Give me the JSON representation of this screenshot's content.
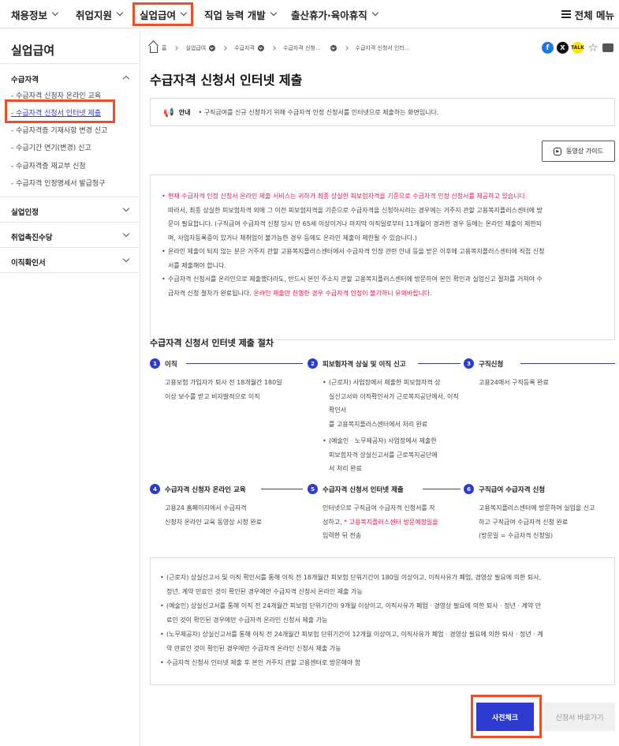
{
  "nav": {
    "items": [
      "채용정보",
      "취업지원",
      "실업급여",
      "직업 능력 개발",
      "출산휴가·육아휴직"
    ],
    "all_menu": "전체 메뉴"
  },
  "sidebar": {
    "title": "실업급여",
    "categories": [
      {
        "label": "수급자격",
        "sub": [
          "수급자격 신청자 온라인 교육",
          "수급자격 신청서 인터넷 제출",
          "수급자격증 기재사항 변경 신고",
          "수급기간 연기(변경) 신고",
          "수급자격증 재교부 신청",
          "수급자격 인정명세서 발급청구"
        ]
      },
      {
        "label": "실업인정"
      },
      {
        "label": "취업촉진수당"
      },
      {
        "label": "이직확인서"
      }
    ]
  },
  "breadcrumb": [
    "홈",
    "실업급여",
    "수급자격",
    "수급자격 신청...",
    "수급자격 신청서 인터..."
  ],
  "page_title": "수급자격 신청서 인터넷 제출",
  "notice": {
    "label": "안내",
    "text": "• 구직급여를 신규 신청하기 위해 수급자격 인정 신청서를 인터넷으로 제출하는 화면입니다."
  },
  "video_guide": "동영상 가이드",
  "info": {
    "p1": "현재 수급자격 인정 신청서 온라인 제출 서비스는 귀하가 최종 상실한 피보험자격을 기준으로 수급자격 인정 신청서를 제공하고 있습니다.",
    "p1b": "따라서, 최종 상실한 피보험자격 외에 그 이전 피보험자격을 기준으로 수급자격을 신청하시려는 경우에는 거주지 관할 고용복지플러스센터에 방",
    "p1c": "문이 필요합니다. (구직급여 수급자격 신청 당시 만 65세 이상이거나 마지막 이직일로부터 11개월이 경과한 경우 등에는 온라인 제출이 제한되",
    "p1d": "며, 사업자등록증이 있거나 재취업이 불가능한 경우 등에도 온라인 제출이 제한될 수 있습니다.)",
    "p2": "온라인 제출이 되지 않는 분은 거주지 관할 고용복지플러스센터에서 수급자격 인정 관련 안내 등을 받은 이후에 고용복지플러스센터에 직접 신청",
    "p2b": "서를 제출해야 합니다.",
    "p3": "수급자격 신청서를 온라인으로 제출했더라도, 반드시 본인 주소지 관할 고용복지플러스센터에 방문하여 본인 확인과 실업신고 절차를 거쳐야 수",
    "p3b": "급자격 신청 절차가 완료됩니다. ",
    "p3_red": "온라인 제출만 진행한 경우 수급자격 인정이 불가하니 유의바랍니다."
  },
  "procedure_title": "수급자격 신청서 인터넷 제출 절차",
  "steps": [
    {
      "num": "1",
      "title": "이직",
      "lines": [
        "고용보험 가입자가 퇴사 전 18개월간 180일",
        "이상 보수를 받고 비자발적으로 이직"
      ]
    },
    {
      "num": "2",
      "title": "피보험자격 상실 및 이직 신고",
      "b1": [
        "(근로자) 사업장에서 제출한 피보험자격 상",
        "실신고서와 이직확인서가 근로복지공단에서, 이직확인서",
        "를 고용복지플러스센터에서 처리 완료"
      ],
      "b2": [
        "(예술인 · 노무제공자) 사업장에서 제출한",
        "피보험자격 상실신고서를 근로복지공단에",
        "서 처리 완료"
      ]
    },
    {
      "num": "3",
      "title": "구직신청",
      "lines": [
        "고용24에서 구직등록 완료"
      ]
    },
    {
      "num": "4",
      "title": "수급자격 신청자 온라인 교육",
      "lines": [
        "고용24 홈페이지에서 수급자격",
        "신청자 온라인 교육 동영상 시청 완료"
      ]
    },
    {
      "num": "5",
      "title": "수급자격 신청서 인터넷 제출",
      "lines": [
        "인터넷으로 구직급여 수급자격 신청서를 작",
        "성하고, ",
        "입력한 뒤 전송"
      ],
      "red": "* 고용복지플러스센터 방문예정일을"
    },
    {
      "num": "6",
      "title": "구직급여 수급자격 신청",
      "lines": [
        "고용복지플러스센터에 방문하여 실업을 신고",
        "하고 구직급여 수급자격 신청 완료",
        "(방문일 = 수급자격 신청일)"
      ]
    }
  ],
  "conditions": [
    "(근로자) 상실신고서 및 이직 확인서를 통해 이직 전 18개월간 피보험 단위기간이 180일 이상이고, 이직사유가 폐업, 경영상 필요에 의한 퇴사,",
    "정년, 계약 만료인 것이 확인된 경우에만 수급자격 신청서 온라인 제출 가능",
    "(예술인) 상실신고서를 통해 이직 전 24개월간 피보험 단위기간이 9개월 이상이고, 이직사유가 폐업 · 경영상 필요에 의한 퇴사 · 정년 · 계약 만",
    "료인 것이 확인된 경우에만 수급자격 온라인 신청서 제출 가능",
    "(노무제공자) 상실신고서를 통해 이직 전 24개월간 피보험 단위기간이 12개월 이상이고, 이직사유가 폐업 · 경영상 필요에 의한 퇴사 · 정년 · 계",
    "약 만료인 것이 확인된 경우에만 수급자격 온라인 신청서 제출 가능",
    "수급자격 신청서 인터넷 제출 후 본인 거주지 관할 고용센터로 방문해야 함"
  ],
  "buttons": {
    "precheck": "사전체크",
    "goto": "신청서 바로가기"
  },
  "colors": {
    "accent": "#2d3bd0",
    "highlight": "#f04e2a",
    "warning": "#e0184c"
  }
}
